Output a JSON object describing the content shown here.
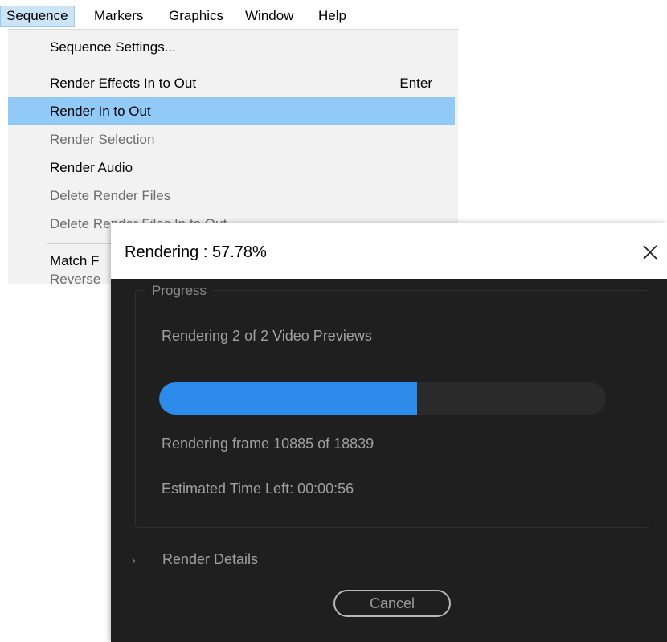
{
  "menubar": {
    "items": [
      {
        "label": "Sequence",
        "active": true
      },
      {
        "label": "Markers"
      },
      {
        "label": "Graphics"
      },
      {
        "label": "Window"
      },
      {
        "label": "Help"
      }
    ]
  },
  "dropdown": {
    "items": [
      {
        "label": "Sequence Settings...",
        "enabled": true
      },
      {
        "label": "Render Effects In to Out",
        "shortcut": "Enter",
        "enabled": true
      },
      {
        "label": "Render In to Out",
        "enabled": true,
        "highlighted": true
      },
      {
        "label": "Render Selection",
        "enabled": false
      },
      {
        "label": "Render Audio",
        "enabled": true
      },
      {
        "label": "Delete Render Files",
        "enabled": false
      },
      {
        "label": "Delete Render Files In to Out",
        "enabled": false
      },
      {
        "label": "Match F",
        "enabled": true
      },
      {
        "label": "Reverse",
        "enabled": false
      }
    ]
  },
  "dialog": {
    "title": "Rendering : 57.78%",
    "progress_group_label": "Progress",
    "status": "Rendering 2 of 2 Video Previews",
    "progress_fraction": 0.5778,
    "frame_status": "Rendering frame 10885 of 18839",
    "time_left": "Estimated Time Left: 00:00:56",
    "details_label": "Render Details",
    "cancel_label": "Cancel"
  },
  "colors": {
    "menu_highlight": "#91c9f7",
    "progress_fill": "#2d8ceb",
    "dialog_bg": "#1f1f1f"
  },
  "icons": {
    "close": "close-icon",
    "expand": "chevron-right-icon"
  }
}
